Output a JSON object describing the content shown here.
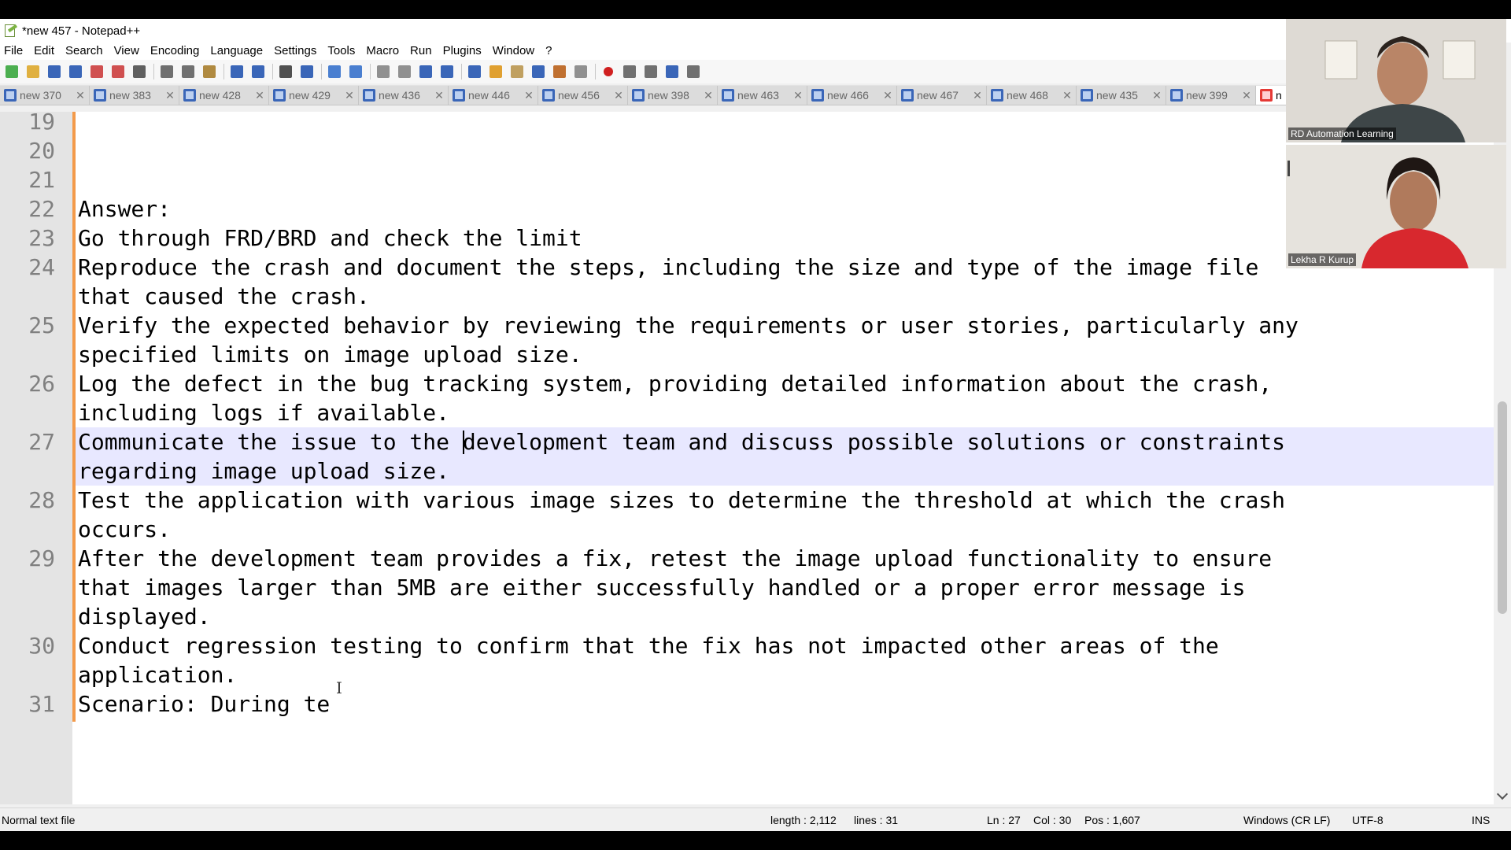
{
  "window": {
    "title": "*new 457 - Notepad++"
  },
  "menu": [
    "File",
    "Edit",
    "Search",
    "View",
    "Encoding",
    "Language",
    "Settings",
    "Tools",
    "Macro",
    "Run",
    "Plugins",
    "Window",
    "?"
  ],
  "toolbar_icons": [
    "new-file-icon",
    "open-file-icon",
    "save-icon",
    "save-all-icon",
    "close-icon",
    "close-all-icon",
    "print-icon",
    "cut-icon",
    "copy-icon",
    "paste-icon",
    "undo-icon",
    "redo-icon",
    "find-icon",
    "replace-icon",
    "zoom-in-icon",
    "zoom-out-icon",
    "sync-vertical-icon",
    "sync-horizontal-icon",
    "word-wrap-icon",
    "show-all-chars-icon",
    "indent-guide-icon",
    "udl-icon",
    "doc-map-icon",
    "function-list-icon",
    "folder-workspace-icon",
    "monitoring-icon",
    "record-macro-icon",
    "stop-record-icon",
    "play-macro-icon",
    "run-macro-multiple-icon",
    "save-macro-icon"
  ],
  "tabs": [
    {
      "label": "new 370"
    },
    {
      "label": "new 383"
    },
    {
      "label": "new 428"
    },
    {
      "label": "new 429"
    },
    {
      "label": "new 436"
    },
    {
      "label": "new 446"
    },
    {
      "label": "new 456"
    },
    {
      "label": "new 398"
    },
    {
      "label": "new 463"
    },
    {
      "label": "new 466"
    },
    {
      "label": "new 467"
    },
    {
      "label": "new 468"
    },
    {
      "label": "new 435"
    },
    {
      "label": "new 399"
    },
    {
      "label": "n",
      "active": true
    }
  ],
  "editor": {
    "current_line": "27",
    "lines": [
      {
        "num": "19",
        "rows": [
          ""
        ]
      },
      {
        "num": "20",
        "rows": [
          ""
        ]
      },
      {
        "num": "21",
        "rows": [
          ""
        ]
      },
      {
        "num": "22",
        "rows": [
          "Answer:"
        ]
      },
      {
        "num": "23",
        "rows": [
          "Go through FRD/BRD and check the limit"
        ]
      },
      {
        "num": "24",
        "rows": [
          "Reproduce the crash and document the steps, including the size and type of the image file",
          "that caused the crash."
        ]
      },
      {
        "num": "25",
        "rows": [
          "Verify the expected behavior by reviewing the requirements or user stories, particularly any",
          "specified limits on image upload size."
        ]
      },
      {
        "num": "26",
        "rows": [
          "Log the defect in the bug tracking system, providing detailed information about the crash,",
          "including logs if available."
        ]
      },
      {
        "num": "27",
        "rows": [
          "Communicate the issue to the development team and discuss possible solutions or constraints",
          "regarding image upload size."
        ]
      },
      {
        "num": "28",
        "rows": [
          "Test the application with various image sizes to determine the threshold at which the crash",
          "occurs."
        ]
      },
      {
        "num": "29",
        "rows": [
          "After the development team provides a fix, retest the image upload functionality to ensure",
          "that images larger than 5MB are either successfully handled or a proper error message is",
          "displayed."
        ]
      },
      {
        "num": "30",
        "rows": [
          "Conduct regression testing to confirm that the fix has not impacted other areas of the",
          "application."
        ]
      },
      {
        "num": "31",
        "rows": [
          "Scenario: During te"
        ]
      }
    ]
  },
  "status": {
    "file_type": "Normal text file",
    "length": "length : 2,112",
    "lines": "lines : 31",
    "ln": "Ln : 27",
    "col": "Col : 30",
    "pos": "Pos : 1,607",
    "eol": "Windows (CR LF)",
    "encoding": "UTF-8",
    "mode": "INS"
  },
  "participants": [
    {
      "name": "RD Automation Learning"
    },
    {
      "name": "Lekha R Kurup"
    }
  ],
  "colors": {
    "gutter_bg": "#e4e4e4",
    "line_number": "#808080",
    "change_marker": "#f39a4a",
    "current_line_highlight": "#e8e8ff",
    "active_tab_icon": "#e53935",
    "tab_icon": "#3a66b8"
  }
}
